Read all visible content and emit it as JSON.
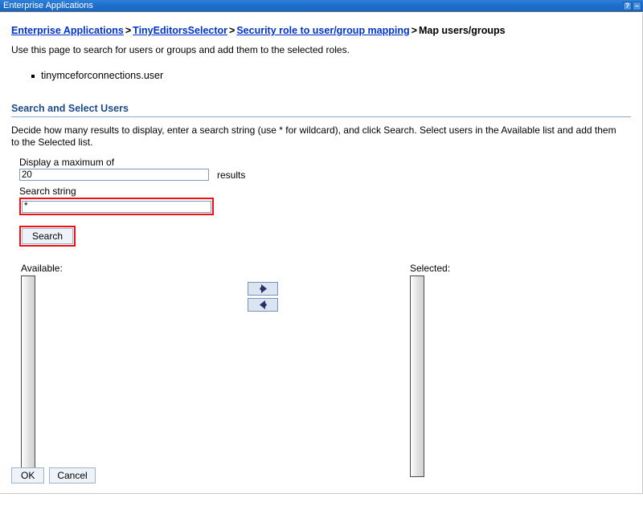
{
  "window": {
    "title": "Enterprise Applications",
    "help_button_label": "?",
    "minimize_button_label": "–",
    "titlebar_color": "#1c6fce"
  },
  "breadcrumb": {
    "separator": ">",
    "items": [
      {
        "label": "Enterprise Applications",
        "is_link": true
      },
      {
        "label": "TinyEditorsSelector",
        "is_link": true
      },
      {
        "label": "Security role to user/group mapping",
        "is_link": true
      },
      {
        "label": "Map users/groups",
        "is_link": false
      }
    ],
    "link_color": "#0033cc"
  },
  "page": {
    "description": "Use this page to search for users or groups and add them to the selected roles.",
    "roles": [
      "tinymceforconnections.user"
    ]
  },
  "section": {
    "header": "Search and Select Users",
    "header_color": "#1b4a8c",
    "description": "Decide how many results to display, enter a search string (use * for wildcard), and click Search. Select users in the Available list and add them to the Selected list."
  },
  "form": {
    "max_results": {
      "label": "Display a maximum of",
      "value": "20",
      "placeholder": "",
      "units_label": "results"
    },
    "search_string": {
      "label": "Search string",
      "value": "*",
      "placeholder": "",
      "highlighted": true,
      "highlight_color": "#ee1111"
    },
    "search_button": {
      "label": "Search",
      "highlighted": true,
      "highlight_color": "#ee1111"
    }
  },
  "dual_list": {
    "available": {
      "label": "Available:",
      "items": []
    },
    "selected": {
      "label": "Selected:",
      "items": []
    },
    "add_button": {
      "icon": "arrow-right-icon",
      "title": "Add"
    },
    "remove_button": {
      "icon": "arrow-left-icon",
      "title": "Remove"
    },
    "arrow_color": "#2b2f66"
  },
  "footer": {
    "ok_label": "OK",
    "cancel_label": "Cancel"
  }
}
